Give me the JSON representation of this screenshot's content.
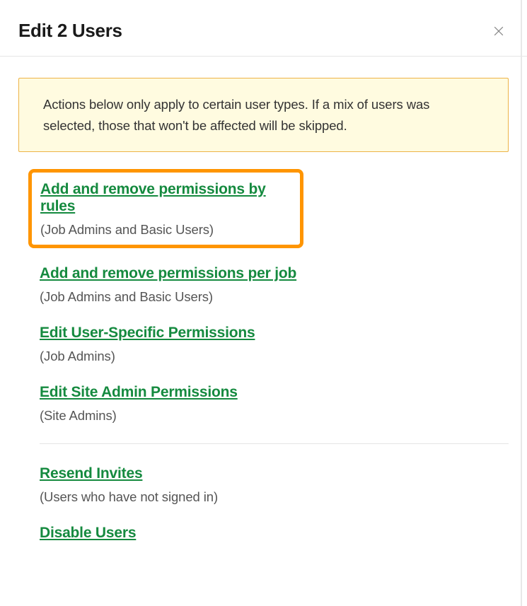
{
  "modal": {
    "title": "Edit 2 Users",
    "banner_text": "Actions below only apply to certain user types. If a mix of users was selected, those that won't be affected will be skipped."
  },
  "highlighted_action": {
    "label": "Add and remove permissions by rules",
    "desc": "(Job Admins and Basic Users)"
  },
  "actions_group1": [
    {
      "label": "Add and remove permissions per job",
      "desc": "(Job Admins and Basic Users)"
    },
    {
      "label": "Edit User-Specific Permissions",
      "desc": "(Job Admins)"
    },
    {
      "label": "Edit Site Admin Permissions",
      "desc": "(Site Admins)"
    }
  ],
  "actions_group2": [
    {
      "label": "Resend Invites",
      "desc": "(Users who have not signed in)"
    },
    {
      "label": "Disable Users",
      "desc": ""
    }
  ]
}
